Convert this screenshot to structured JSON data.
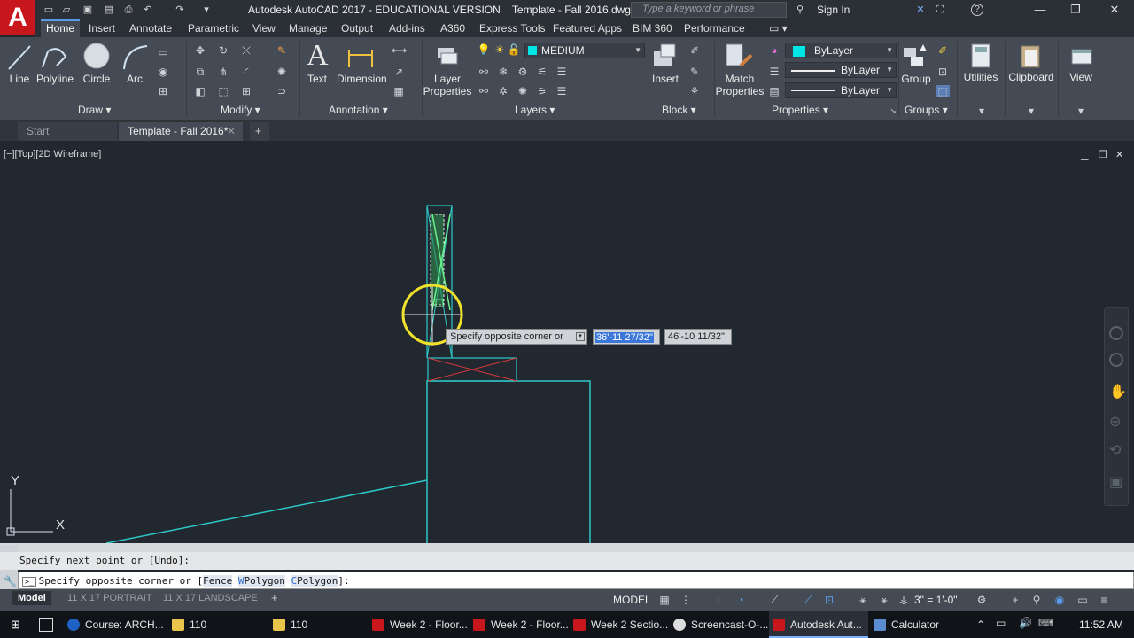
{
  "window": {
    "title": "Autodesk AutoCAD 2017 - EDUCATIONAL VERSION    Template - Fall 2016.dwg",
    "search_placeholder": "Type a keyword or phrase",
    "sign_in": "Sign In",
    "help": "?"
  },
  "ribbon_tabs": [
    "Home",
    "Insert",
    "Annotate",
    "Parametric",
    "View",
    "Manage",
    "Output",
    "Add-ins",
    "A360",
    "Express Tools",
    "Featured Apps",
    "BIM 360",
    "Performance"
  ],
  "ribbon": {
    "draw": {
      "title": "Draw",
      "tools": [
        "Line",
        "Polyline",
        "Circle",
        "Arc"
      ]
    },
    "modify": {
      "title": "Modify"
    },
    "annotation": {
      "title": "Annotation",
      "tools": [
        "Text",
        "Dimension"
      ]
    },
    "layers": {
      "title": "Layers",
      "layer_props": "Layer\nProperties",
      "current_layer": "MEDIUM",
      "current_layer_color": "#00e5e5"
    },
    "block": {
      "title": "Block",
      "insert": "Insert"
    },
    "properties": {
      "title": "Properties",
      "match": "Match\nProperties",
      "color": "ByLayer",
      "linetype": "ByLayer",
      "lineweight": "ByLayer"
    },
    "groups": {
      "title": "Groups",
      "group": "Group"
    },
    "utilities": "Utilities",
    "clipboard": "Clipboard",
    "view": "View"
  },
  "file_tabs": {
    "start": "Start",
    "active": "Template - Fall 2016*"
  },
  "viewport": {
    "label": "[−][Top][2D Wireframe]",
    "ucs_x": "X",
    "ucs_y": "Y"
  },
  "dynamic_input": {
    "prompt": "Specify opposite corner or",
    "value1": "36'-11 27/32\"",
    "value2": "46'-10 11/32\""
  },
  "command_line": {
    "history": "Specify next point or [Undo]:",
    "current_prefix": "Specify opposite corner or [",
    "option1": "Fence",
    "option2_key": "W",
    "option2_rest": "Polygon",
    "option3_key": "C",
    "option3_rest": "Polygon",
    "suffix": "]:"
  },
  "layout_tabs": [
    "Model",
    "11 X 17 PORTRAIT",
    "11 X 17 LANDSCAPE"
  ],
  "status": {
    "mode": "MODEL",
    "scale": "3\" = 1'-0\""
  },
  "taskbar": {
    "items": [
      {
        "label": "Course: ARCH...",
        "color": "#1d62c4"
      },
      {
        "label": "110",
        "color": "#e8c44a"
      },
      {
        "label": "110",
        "color": "#e8c44a"
      },
      {
        "label": "Week 2 - Floor...",
        "color": "#c8161d"
      },
      {
        "label": "Week 2 - Floor...",
        "color": "#c8161d"
      },
      {
        "label": "Week 2 Sectio...",
        "color": "#c8161d"
      },
      {
        "label": "Screencast-O-...",
        "color": "#dddddd"
      },
      {
        "label": "Autodesk Aut...",
        "color": "#c8161d"
      },
      {
        "label": "Calculator",
        "color": "#5b8bd1"
      }
    ],
    "clock": "11:52 AM"
  }
}
